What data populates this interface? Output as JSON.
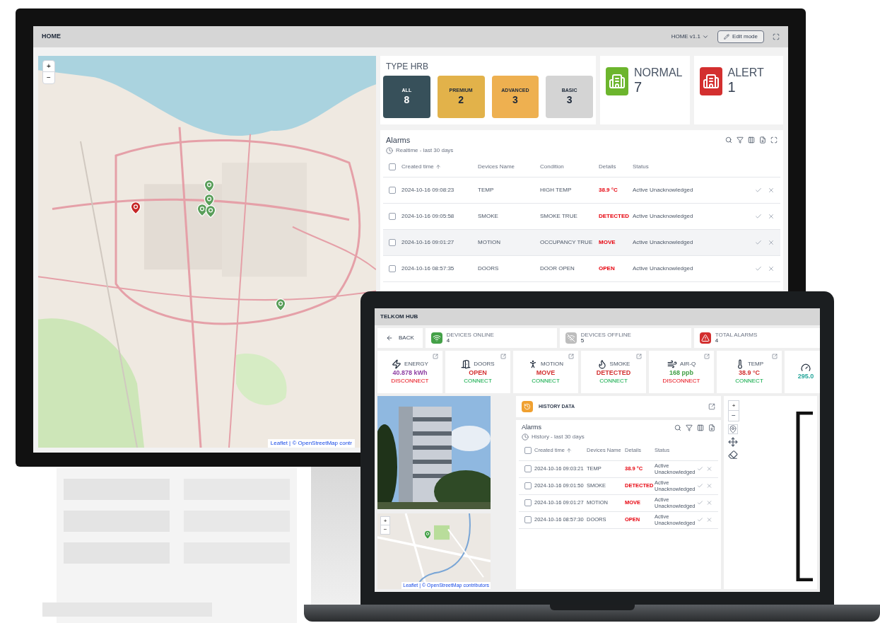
{
  "monitor": {
    "title": "HOME",
    "dashboard_select": "HOME v1.1",
    "edit_button": "Edit mode",
    "map": {
      "zoom_in": "+",
      "zoom_out": "−",
      "attribution": "Leaflet | © OpenStreetMap contr",
      "markers": [
        {
          "color": "#c62828"
        },
        {
          "color": "#5a9e5a"
        },
        {
          "color": "#5a9e5a"
        },
        {
          "color": "#5a9e5a"
        },
        {
          "color": "#5a9e5a"
        },
        {
          "color": "#5a9e5a"
        }
      ]
    },
    "type_hrb": {
      "title": "TYPE HRB",
      "tiles": [
        {
          "label": "ALL",
          "count": "8",
          "color": "#37505a"
        },
        {
          "label": "PREMIUM",
          "count": "2",
          "color": "#e2b24a"
        },
        {
          "label": "ADVANCED",
          "count": "3",
          "color": "#eeb050"
        },
        {
          "label": "BASIC",
          "count": "3",
          "color": "#d4d4d4"
        }
      ]
    },
    "status_cards": [
      {
        "label": "NORMAL",
        "count": "7",
        "color": "#6cb52d"
      },
      {
        "label": "ALERT",
        "count": "1",
        "color": "#d32f2f"
      }
    ],
    "alarms": {
      "title": "Alarms",
      "subtitle": "Realtime - last 30 days",
      "all_checked": false,
      "columns": [
        {
          "label": "Created time",
          "kind": "sorted"
        },
        {
          "label": "Devices Name",
          "kind": "plain"
        },
        {
          "label": "Condition",
          "kind": "plain"
        },
        {
          "label": "Details",
          "kind": "alert"
        },
        {
          "label": "Status",
          "kind": "plain"
        }
      ],
      "rows": [
        {
          "cells": [
            "2024-10-16 09:08:23",
            "TEMP",
            "HIGH TEMP",
            "38.9 °C",
            "Active Unacknowledged"
          ],
          "checked": false,
          "selected": false
        },
        {
          "cells": [
            "2024-10-16 09:05:58",
            "SMOKE",
            "SMOKE TRUE",
            "DETECTED",
            "Active Unacknowledged"
          ],
          "checked": false,
          "selected": false
        },
        {
          "cells": [
            "2024-10-16 09:01:27",
            "MOTION",
            "OCCUPANCY TRUE",
            "MOVE",
            "Active Unacknowledged"
          ],
          "checked": false,
          "selected": true
        },
        {
          "cells": [
            "2024-10-16 08:57:35",
            "DOORS",
            "DOOR OPEN",
            "OPEN",
            "Active Unacknowledged"
          ],
          "checked": false,
          "selected": false
        }
      ]
    }
  },
  "laptop": {
    "title": "TELKOM HUB",
    "back": "BACK",
    "summary": [
      {
        "label": "DEVICES ONLINE",
        "count": "4",
        "color": "#43a047"
      },
      {
        "label": "DEVICES OFFLINE",
        "count": "5",
        "color": "#bdbdbd"
      },
      {
        "label": "TOTAL ALARMS",
        "count": "4",
        "color": "#d32f2f"
      }
    ],
    "sensors": [
      {
        "kind": "energy",
        "label": "ENERGY",
        "value": "40.878 kWh",
        "color": "#8e3fa3",
        "state": "DISCONNECT",
        "connected": false
      },
      {
        "kind": "door",
        "label": "DOORS",
        "value": "OPEN",
        "color": "#d32f2f",
        "state": "CONNECT",
        "connected": true
      },
      {
        "kind": "motion",
        "label": "MOTION",
        "value": "MOVE",
        "color": "#d32f2f",
        "state": "CONNECT",
        "connected": true
      },
      {
        "kind": "smoke",
        "label": "SMOKE",
        "value": "DETECTED",
        "color": "#d32f2f",
        "state": "CONNECT",
        "connected": true
      },
      {
        "kind": "air",
        "label": "AIR-Q",
        "value": "168 ppb",
        "color": "#43a047",
        "state": "DISCONNECT",
        "connected": false
      },
      {
        "kind": "temp",
        "label": "TEMP",
        "value": "38.9 °C",
        "color": "#d32f2f",
        "state": "CONNECT",
        "connected": true
      },
      {
        "kind": "partial",
        "value": "295.0",
        "color": "#26a69a"
      }
    ],
    "history": {
      "title": "HISTORY DATA"
    },
    "alarms": {
      "title": "Alarms",
      "subtitle": "History - last 30 days",
      "all_checked": false,
      "columns": [
        {
          "label": "Created time",
          "kind": "sorted"
        },
        {
          "label": "Devices Name",
          "kind": "plain"
        },
        {
          "label": "Details",
          "kind": "alert"
        },
        {
          "label": "Status",
          "kind": "plain"
        }
      ],
      "rows": [
        {
          "cells": [
            "2024-10-16 09:03:21",
            "TEMP",
            "38.9 °C",
            "Active Unacknowledged"
          ],
          "checked": false,
          "selected": false
        },
        {
          "cells": [
            "2024-10-16 09:01:50",
            "SMOKE",
            "DETECTED",
            "Active Unacknowledged"
          ],
          "checked": false,
          "selected": false
        },
        {
          "cells": [
            "2024-10-16 09:01:27",
            "MOTION",
            "MOVE",
            "Active Unacknowledged"
          ],
          "checked": false,
          "selected": false
        },
        {
          "cells": [
            "2024-10-16 08:57:30",
            "DOORS",
            "OPEN",
            "Active Unacknowledged"
          ],
          "checked": false,
          "selected": false
        }
      ]
    },
    "minimap": {
      "zoom_in": "+",
      "zoom_out": "−",
      "attribution": "Leaflet | © OpenStreetMap contributors"
    },
    "canvas_tools": {
      "zoom_in": "+",
      "zoom_out": "−"
    }
  }
}
